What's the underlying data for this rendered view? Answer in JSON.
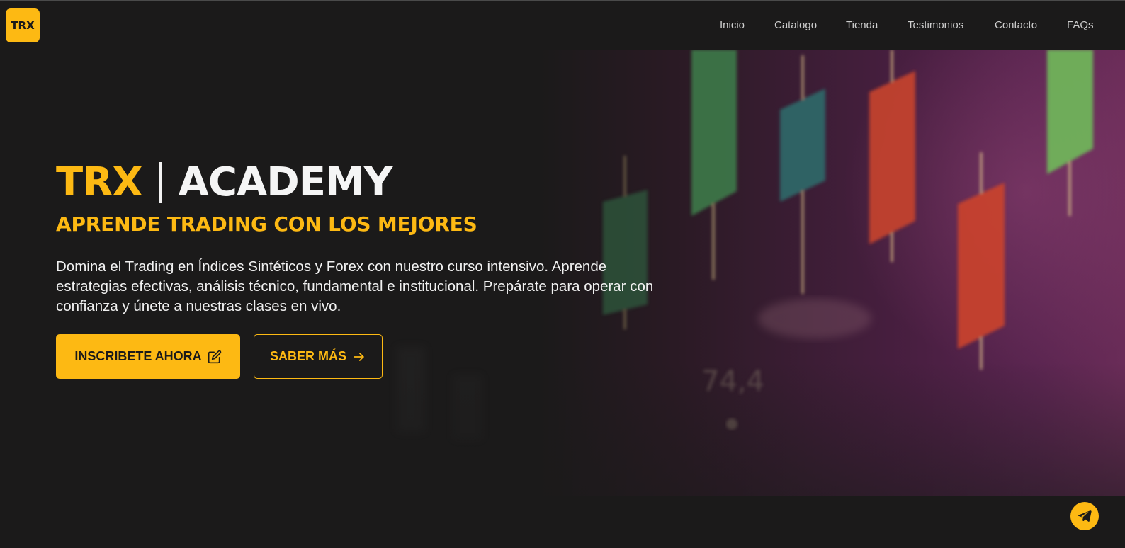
{
  "brand": {
    "logo_text": "TRX",
    "accent_color": "#fdb913",
    "background_color": "#1b1a1a"
  },
  "nav": {
    "items": [
      {
        "label": "Inicio"
      },
      {
        "label": "Catalogo"
      },
      {
        "label": "Tienda"
      },
      {
        "label": "Testimonios"
      },
      {
        "label": "Contacto"
      },
      {
        "label": "FAQs"
      }
    ]
  },
  "hero": {
    "title_brand": "TRX",
    "title_rest": "ACADEMY",
    "subtitle": "APRENDE TRADING CON LOS MEJORES",
    "description": "Domina el Trading en Índices Sintéticos y Forex con nuestro curso intensivo. Aprende estrategias efectivas, análisis técnico, fundamental e institucional. Prepárate para operar con confianza y únete a nuestras clases en vivo.",
    "primary_button": {
      "label": "INSCRIBETE AHORA",
      "icon": "edit-icon"
    },
    "secondary_button": {
      "label": "SABER MÁS",
      "icon": "arrow-right-icon"
    },
    "background_readout": "74,4"
  },
  "floating": {
    "telegram_icon": "telegram-icon"
  }
}
